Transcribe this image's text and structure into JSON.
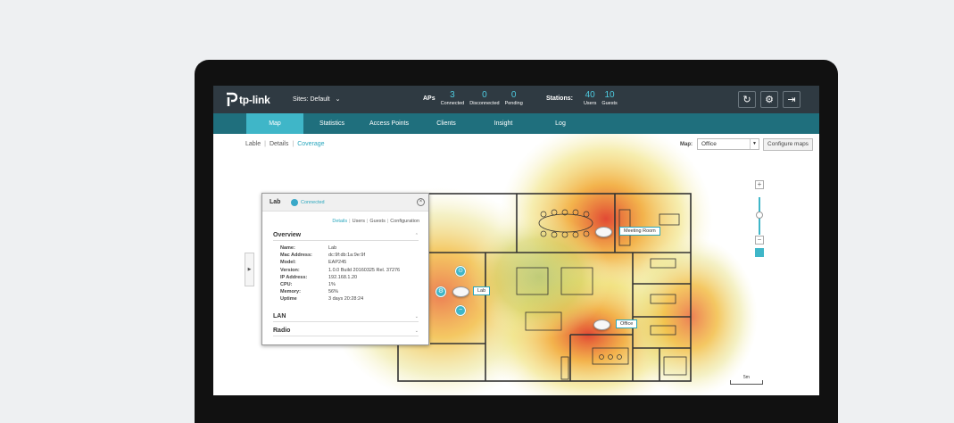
{
  "brand": {
    "logo_text": "tp-link"
  },
  "header": {
    "sites_label": "Sites: Default",
    "aps": {
      "title": "APs",
      "connected": "3",
      "connected_label": "Connected",
      "disconnected": "0",
      "disconnected_label": "Disconnected",
      "pending": "0",
      "pending_label": "Pending"
    },
    "stations": {
      "title": "Stations:",
      "users": "40",
      "users_label": "Users",
      "guests": "10",
      "guests_label": "Guests"
    },
    "icons": [
      "refresh-icon",
      "gear-icon",
      "logout-icon"
    ]
  },
  "nav": {
    "items": [
      "Map",
      "Statistics",
      "Access Points",
      "Clients",
      "Insight",
      "Log"
    ],
    "active": "Map"
  },
  "view": {
    "crumbs": [
      "Lable",
      "Details",
      "Coverage"
    ],
    "active_crumb": "Coverage",
    "map_label": "Map:",
    "map_value": "Office",
    "configure_button": "Configure maps"
  },
  "panel": {
    "name": "Lab",
    "status": "Connected",
    "tabs": [
      "Details",
      "Users",
      "Guests",
      "Configuration"
    ],
    "overview_title": "Overview",
    "overview": [
      {
        "key": "Name:",
        "value": "Lab"
      },
      {
        "key": "Mac Address:",
        "value": "dc:9f:db:1a:9e:9f"
      },
      {
        "key": "Model:",
        "value": "EAP245"
      },
      {
        "key": "Version:",
        "value": "1.0.0 Build 20160325 Rel. 37276"
      },
      {
        "key": "IP Address:",
        "value": "192.168.1.20"
      },
      {
        "key": "CPU:",
        "value": "1%"
      },
      {
        "key": "Memory:",
        "value": "56%"
      },
      {
        "key": "Uptime",
        "value": "3 days 20:28:24"
      }
    ],
    "lan_title": "LAN",
    "radio_title": "Radio"
  },
  "access_points": [
    {
      "label": "Meeting Room"
    },
    {
      "label": "Lab"
    },
    {
      "label": "Office"
    }
  ],
  "scale_label": "5m",
  "colors": {
    "topbar": "#2f3a42",
    "nav": "#1f6f7d",
    "accent": "#3fb6c8",
    "heat_hot": "#e0402a",
    "heat_warm": "#f0b020",
    "heat_cool": "#e8e8a0"
  }
}
